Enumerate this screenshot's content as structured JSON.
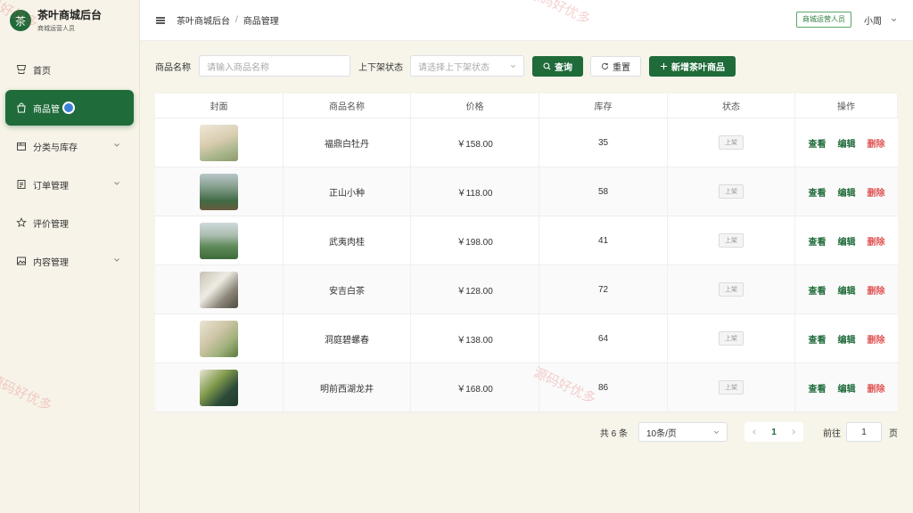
{
  "brand": {
    "logo": "茶",
    "title": "茶叶商城后台",
    "subtitle": "商城运营人员"
  },
  "sidebar": {
    "items": [
      {
        "label": "首页",
        "icon": "shop-icon",
        "active": false,
        "expandable": false
      },
      {
        "label": "商品管",
        "icon": "bag-icon",
        "active": true,
        "expandable": false
      },
      {
        "label": "分类与库存",
        "icon": "box-icon",
        "active": false,
        "expandable": true
      },
      {
        "label": "订单管理",
        "icon": "document-icon",
        "active": false,
        "expandable": true
      },
      {
        "label": "评价管理",
        "icon": "star-icon",
        "active": false,
        "expandable": false
      },
      {
        "label": "内容管理",
        "icon": "image-icon",
        "active": false,
        "expandable": true
      }
    ]
  },
  "header": {
    "breadcrumb": [
      "茶叶商城后台",
      "商品管理"
    ],
    "role_badge": "商城运营人员",
    "user": "小周"
  },
  "toolbar": {
    "name_label": "商品名称",
    "name_placeholder": "请输入商品名称",
    "status_label": "上下架状态",
    "status_placeholder": "请选择上下架状态",
    "search_btn": "查询",
    "reset_btn": "重置",
    "add_btn": "新增茶叶商品"
  },
  "table": {
    "columns": [
      "封面",
      "商品名称",
      "价格",
      "库存",
      "状态",
      "操作"
    ],
    "rows": [
      {
        "name": "福鼎白牡丹",
        "price": "￥158.00",
        "stock": "35",
        "status": "上架"
      },
      {
        "name": "正山小种",
        "price": "￥118.00",
        "stock": "58",
        "status": "上架"
      },
      {
        "name": "武夷肉桂",
        "price": "￥198.00",
        "stock": "41",
        "status": "上架"
      },
      {
        "name": "安吉白茶",
        "price": "￥128.00",
        "stock": "72",
        "status": "上架"
      },
      {
        "name": "洞庭碧螺春",
        "price": "￥138.00",
        "stock": "64",
        "status": "上架"
      },
      {
        "name": "明前西湖龙井",
        "price": "￥168.00",
        "stock": "86",
        "status": "上架"
      }
    ],
    "actions": {
      "view": "查看",
      "edit": "编辑",
      "delete": "删除"
    }
  },
  "pagination": {
    "total": "共 6 条",
    "page_size": "10条/页",
    "current_page": "1",
    "goto_label": "前往",
    "goto_value": "1",
    "page_suffix": "页"
  },
  "watermark": "源码好优多",
  "colors": {
    "primary": "#1f6b3a",
    "danger": "#e05454",
    "background": "#f7f4ea"
  }
}
